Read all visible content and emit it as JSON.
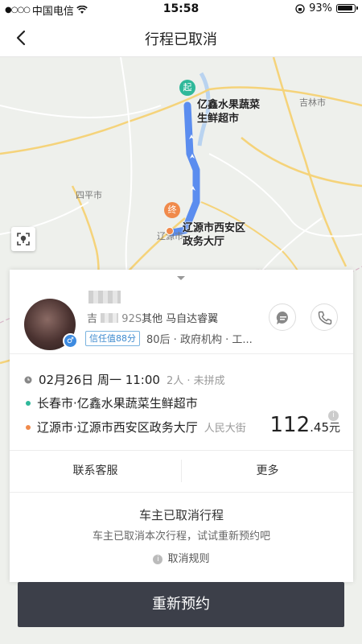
{
  "status_bar": {
    "signal": "●○○○",
    "carrier": "中国电信",
    "time": "15:58",
    "battery": "93%"
  },
  "nav": {
    "title": "行程已取消"
  },
  "map": {
    "cities": [
      "吉林市",
      "四平市",
      "辽源市"
    ],
    "start_pin": "起",
    "end_pin": "终",
    "start_label_line1": "亿鑫水果蔬菜",
    "start_label_line2": "生鲜超市",
    "end_label_line1": "辽源市西安区",
    "end_label_line2": "政务大厅",
    "route_color": "#5b8def",
    "start_color": "#2fb89a",
    "end_color": "#f08a4b"
  },
  "driver": {
    "plate_prefix": "吉",
    "plate_suffix": "92S",
    "car": "其他 马自达睿翼",
    "trust_badge": "信任值88分",
    "tags": "80后 · 政府机构 · 工...",
    "gender_icon": "♂"
  },
  "trip": {
    "date_time": "02月26日 周一 11:00",
    "meta": "2人 · 未拼成",
    "from": "长春市·亿鑫水果蔬菜生鲜超市",
    "to": "辽源市·辽源市西安区政务大厅",
    "to_extra": "人民大街",
    "price_int": "112",
    "price_dec": ".45",
    "price_unit": "元"
  },
  "actions": {
    "contact": "联系客服",
    "more": "更多"
  },
  "cancel": {
    "title": "车主已取消行程",
    "subtitle": "车主已取消本次行程，试试重新预约吧",
    "rules": "取消规则"
  },
  "primary_button": "重新预约"
}
